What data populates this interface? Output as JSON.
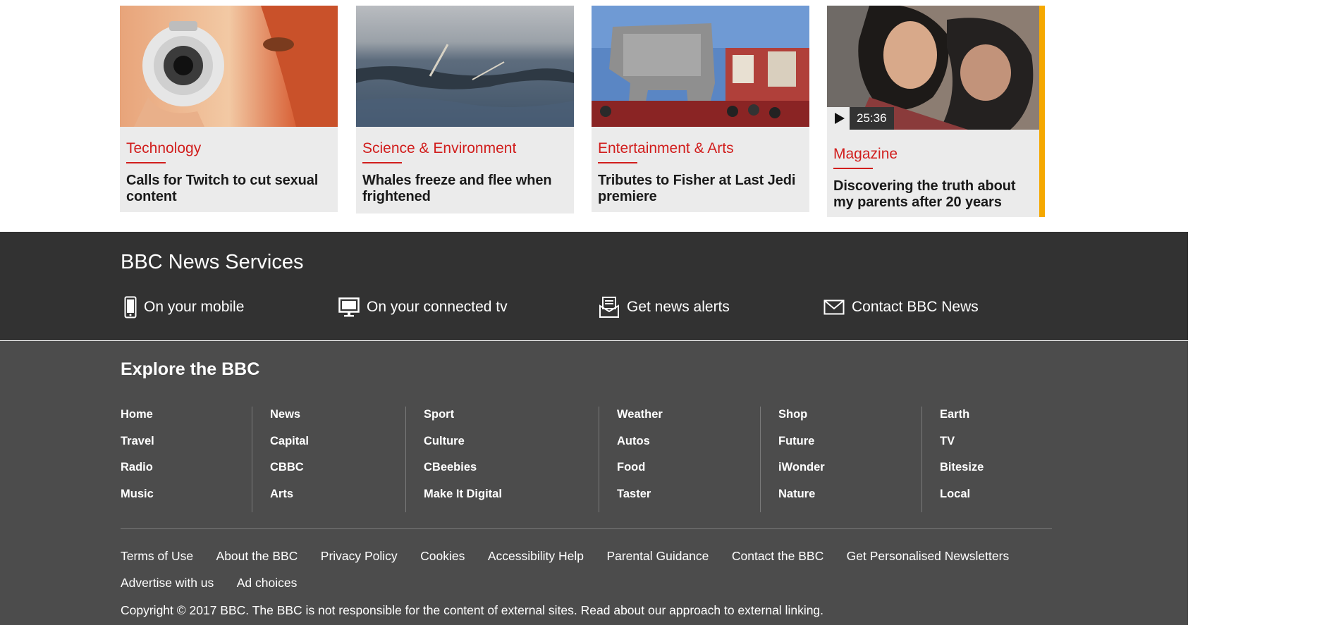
{
  "stories": [
    {
      "section": "Technology",
      "headline": "Calls for Twitch to cut sexual content"
    },
    {
      "section": "Science & Environment",
      "headline": "Whales freeze and flee when frightened"
    },
    {
      "section": "Entertainment & Arts",
      "headline": "Tributes to Fisher at Last Jedi premiere"
    },
    {
      "section": "Magazine",
      "headline": "Discovering the truth about my parents after 20 years",
      "duration": "25:36"
    }
  ],
  "services": {
    "title": "BBC News Services",
    "items": [
      {
        "label": "On your mobile",
        "icon": "mobile-icon"
      },
      {
        "label": "On your connected tv",
        "icon": "tv-icon"
      },
      {
        "label": "Get news alerts",
        "icon": "alerts-icon"
      },
      {
        "label": "Contact BBC News",
        "icon": "envelope-icon"
      }
    ]
  },
  "explore": {
    "title": "Explore the BBC",
    "columns": [
      [
        "Home",
        "Travel",
        "Radio",
        "Music"
      ],
      [
        "News",
        "Capital",
        "CBBC",
        "Arts"
      ],
      [
        "Sport",
        "Culture",
        "CBeebies",
        "Make It Digital"
      ],
      [
        "Weather",
        "Autos",
        "Food",
        "Taster"
      ],
      [
        "Shop",
        "Future",
        "iWonder",
        "Nature"
      ],
      [
        "Earth",
        "TV",
        "Bitesize",
        "Local"
      ]
    ],
    "legal_links": [
      "Terms of Use",
      "About the BBC",
      "Privacy Policy",
      "Cookies",
      "Accessibility Help",
      "Parental Guidance",
      "Contact the BBC",
      "Get Personalised Newsletters",
      "Advertise with us",
      "Ad choices"
    ],
    "copyright": "Copyright © 2017 BBC. The BBC is not responsible for the content of external sites. Read about our approach to external linking."
  },
  "colors": {
    "accent_red": "#d11e1d",
    "magazine_accent": "#f5a800",
    "services_bg": "#323232",
    "explore_bg": "#4c4c4c"
  }
}
